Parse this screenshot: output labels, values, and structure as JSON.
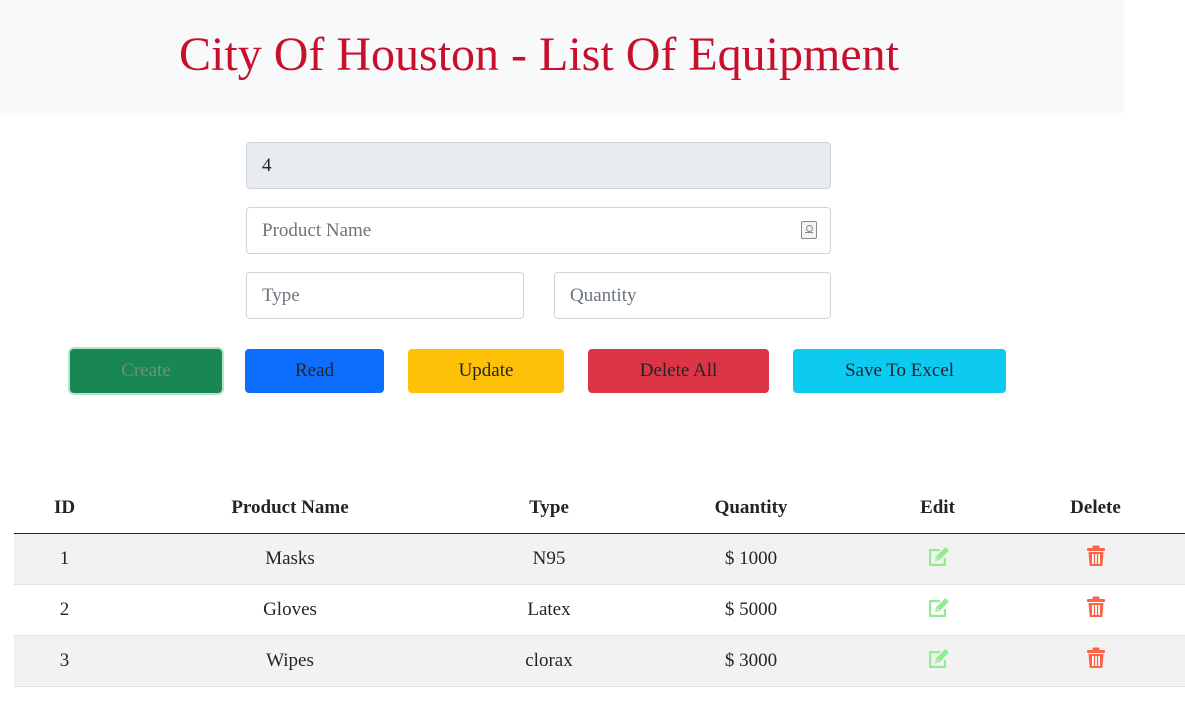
{
  "header": {
    "title": "City Of Houston - List Of Equipment"
  },
  "form": {
    "id_value": "4",
    "product_name_placeholder": "Product Name",
    "type_placeholder": "Type",
    "quantity_placeholder": "Quantity"
  },
  "buttons": {
    "create": "Create",
    "read": "Read",
    "update": "Update",
    "delete_all": "Delete All",
    "save_excel": "Save To Excel"
  },
  "table": {
    "headers": [
      "ID",
      "Product Name",
      "Type",
      "Quantity",
      "Edit",
      "Delete"
    ],
    "rows": [
      {
        "id": "1",
        "name": "Masks",
        "type": "N95",
        "quantity": "$ 1000"
      },
      {
        "id": "2",
        "name": "Gloves",
        "type": "Latex",
        "quantity": "$ 5000"
      },
      {
        "id": "3",
        "name": "Wipes",
        "type": "clorax",
        "quantity": "$ 3000"
      }
    ]
  },
  "icons": {
    "edit": "edit-icon",
    "delete": "trash-icon",
    "autofill": "contact-card-icon"
  },
  "colors": {
    "title": "#c8102e",
    "create": "#198754",
    "read": "#0d6efd",
    "update": "#ffc107",
    "delete_all": "#dc3545",
    "save_excel": "#0dcaf0",
    "edit_icon": "#90ee90",
    "delete_icon": "#ff6347"
  }
}
